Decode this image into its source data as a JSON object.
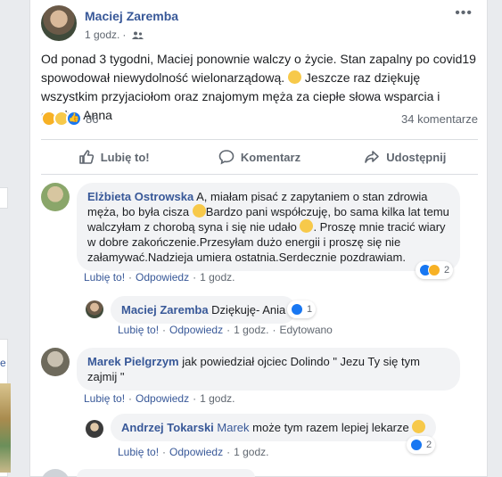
{
  "left_rail": {
    "cut_letter": "e"
  },
  "post": {
    "author": "Maciej Zaremba",
    "time": "1 godz.",
    "privacy_icon": "friends-icon",
    "more_icon": "more-icon",
    "text_parts": [
      "Od ponad 3 tygodni, Maciej ponownie walczy o życie. Stan zapalny po covid19 spowodował niewydolność wielonarządową. ",
      " Jeszcze raz dziękuję wszystkim przyjaciołom oraz znajomym męża za ciepłe słowa wsparcia i otuchy. Anna"
    ],
    "reactions_count": "86",
    "comments_count": "34 komentarze",
    "actions": {
      "like": "Lubię to!",
      "comment": "Komentarz",
      "share": "Udostępnij"
    }
  },
  "comments": [
    {
      "author": "Elżbieta Ostrowska",
      "text_parts": [
        "A, miałam pisać z zapytaniem o stan zdrowia męża, bo była cisza ",
        "Bardzo pani współczuję, bo sama kilka lat temu walczyłam z chorobą syna i się nie udało ",
        ". Proszę mnie tracić wiary w dobre zakończenie.Przesyłam dużo energii i proszę się nie załamywać.Nadzieja umiera ostatnia.Serdecznie pozdrawiam."
      ],
      "like_label": "Lubię to!",
      "reply_label": "Odpowiedz",
      "time": "1 godz.",
      "reaction_count": "2"
    },
    {
      "author": "Maciej Zaremba",
      "text": "Dziękuję- Ania",
      "like_label": "Lubię to!",
      "reply_label": "Odpowiedz",
      "time": "1 godz.",
      "edited": "Edytowano",
      "reaction_count": "1"
    },
    {
      "author": "Marek Pielgrzym",
      "text": "jak powiedział ojciec Dolindo \" Jezu Ty się tym zajmij \"",
      "like_label": "Lubię to!",
      "reply_label": "Odpowiedz",
      "time": "1 godz."
    },
    {
      "author": "Andrzej Tokarski",
      "mention": "Marek",
      "text": "może tym razem lepiej lekarze ",
      "like_label": "Lubię to!",
      "reply_label": "Odpowiedz",
      "time": "1 godz.",
      "reaction_count": "2"
    }
  ],
  "colors": {
    "link": "#385898",
    "meta": "#606770",
    "like_blue": "#1877f2",
    "bubble": "#f2f3f5"
  }
}
